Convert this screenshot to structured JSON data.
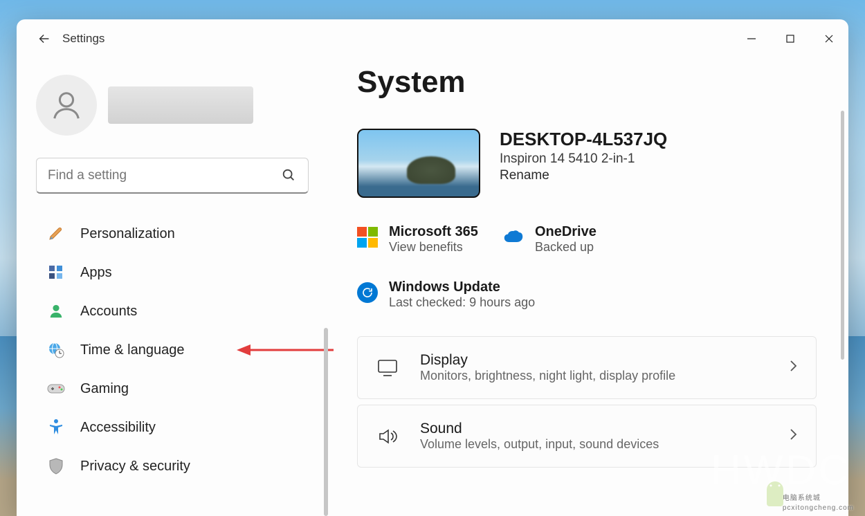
{
  "titlebar": {
    "title": "Settings"
  },
  "search": {
    "placeholder": "Find a setting"
  },
  "sidebar": [
    {
      "icon_name": "personalization-icon",
      "label": "Personalization"
    },
    {
      "icon_name": "apps-icon",
      "label": "Apps"
    },
    {
      "icon_name": "accounts-icon",
      "label": "Accounts"
    },
    {
      "icon_name": "time-language-icon",
      "label": "Time & language",
      "highlighted": true
    },
    {
      "icon_name": "gaming-icon",
      "label": "Gaming"
    },
    {
      "icon_name": "accessibility-icon",
      "label": "Accessibility"
    },
    {
      "icon_name": "privacy-icon",
      "label": "Privacy & security"
    }
  ],
  "main": {
    "page_title": "System",
    "device": {
      "name": "DESKTOP-4L537JQ",
      "model": "Inspiron 14 5410 2-in-1",
      "rename": "Rename"
    },
    "status": {
      "m365": {
        "title": "Microsoft 365",
        "sub": "View benefits"
      },
      "onedrive": {
        "title": "OneDrive",
        "sub": "Backed up"
      },
      "update": {
        "title": "Windows Update",
        "sub": "Last checked: 9 hours ago"
      }
    },
    "cards": {
      "display": {
        "title": "Display",
        "sub": "Monitors, brightness, night light, display profile"
      },
      "sound": {
        "title": "Sound",
        "sub": "Volume levels, output, input, sound devices"
      }
    }
  },
  "watermarks": {
    "w1": "HWDC",
    "w2": "电脑系统城",
    "w2sub": "pcxitongcheng.com"
  }
}
